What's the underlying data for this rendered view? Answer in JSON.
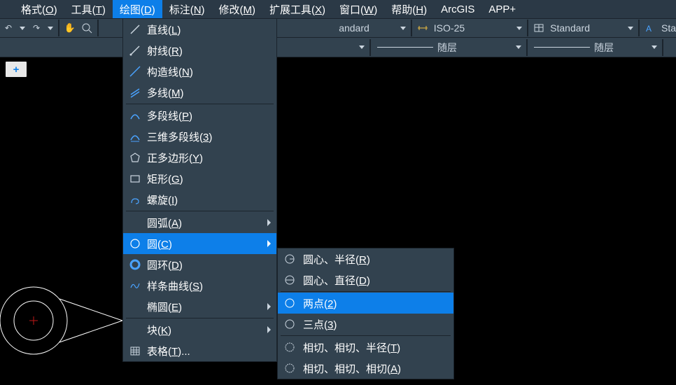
{
  "menubar": {
    "items": [
      {
        "label": "格式(O)"
      },
      {
        "label": "工具(T)"
      },
      {
        "label": "绘图(D)",
        "selected": true
      },
      {
        "label": "标注(N)"
      },
      {
        "label": "修改(M)"
      },
      {
        "label": "扩展工具(X)"
      },
      {
        "label": "窗口(W)"
      },
      {
        "label": "帮助(H)"
      },
      {
        "label": "ArcGIS"
      },
      {
        "label": "APP+"
      }
    ]
  },
  "toolbar": {
    "undo": "↶",
    "redo": "↷",
    "combos": [
      {
        "text": "andard"
      },
      {
        "text": "ISO-25"
      },
      {
        "text": "Standard"
      },
      {
        "text": "Sta"
      }
    ]
  },
  "toolbar2": {
    "bylayer1": "随层",
    "bylayer2": "随层"
  },
  "dropdown": {
    "items": [
      {
        "key": "line",
        "label_html": "直线(<u>L</u>)",
        "icon_svg": "<line x1='3' y1='15' x2='15' y2='3' stroke='#cbd5df' stroke-width='1.5'/>"
      },
      {
        "key": "ray",
        "label_html": "射线(<u>R</u>)",
        "icon_svg": "<line x1='3' y1='15' x2='15' y2='3' stroke='#cbd5df' stroke-width='1.5'/><circle cx='3' cy='15' r='1.5' fill='#cbd5df'/>"
      },
      {
        "key": "xline",
        "label_html": "构造线(<u>N</u>)",
        "icon_svg": "<line x1='2' y1='16' x2='16' y2='2' stroke='#4aa3ff' stroke-width='1.5'/>"
      },
      {
        "key": "mline",
        "label_html": "多线(<u>M</u>)",
        "icon_svg": "<line x1='3' y1='12' x2='15' y2='4' stroke='#4aa3ff' stroke-width='1.5'/><line x1='3' y1='16' x2='15' y2='8' stroke='#4aa3ff' stroke-width='1.5'/>"
      },
      {
        "sep": true
      },
      {
        "key": "pline",
        "label_html": "多段线(<u>P</u>)",
        "icon_svg": "<path d='M3 14 Q9 2 15 14' stroke='#4aa3ff' stroke-width='1.5' fill='none'/>"
      },
      {
        "key": "3dpoly",
        "label_html": "三维多段线(<u>3</u>)",
        "icon_svg": "<path d='M3 14 Q9 2 15 14' stroke='#4aa3ff' stroke-width='1.5' fill='none'/><line x1='3' y1='16' x2='15' y2='16' stroke='#4aa3ff'/>"
      },
      {
        "key": "polygon",
        "label_html": "正多边形(<u>Y</u>)",
        "icon_svg": "<polygon points='9,3 15,7 13,15 5,15 3,7' stroke='#cbd5df' fill='none' stroke-width='1.2'/>"
      },
      {
        "key": "rect",
        "label_html": "矩形(<u>G</u>)",
        "icon_svg": "<rect x='3' y='5' width='12' height='9' stroke='#cbd5df' fill='none' stroke-width='1.2'/>"
      },
      {
        "key": "helix",
        "label_html": "螺旋(<u>I</u>)",
        "icon_svg": "<path d='M4 14 Q4 8 9 8 Q14 8 14 12 Q14 15 10 15' stroke='#4aa3ff' fill='none' stroke-width='1.2'/>"
      },
      {
        "sep": true
      },
      {
        "key": "arc",
        "label_html": "圆弧(<u>A</u>)",
        "has_sub": true,
        "icon_svg": ""
      },
      {
        "key": "circle",
        "label_html": "圆(<u>C</u>)",
        "has_sub": true,
        "highlight": true,
        "icon_svg": "<circle cx='9' cy='9' r='6' stroke='#fff' fill='none' stroke-width='1.2'/>"
      },
      {
        "key": "donut",
        "label_html": "圆环(<u>D</u>)",
        "icon_svg": "<circle cx='9' cy='9' r='6' stroke='#4aa3ff' fill='none' stroke-width='3'/>"
      },
      {
        "key": "spline",
        "label_html": "样条曲线(<u>S</u>)",
        "icon_svg": "<path d='M3 12 Q6 4 9 10 Q12 16 15 6' stroke='#4aa3ff' fill='none' stroke-width='1.2'/>"
      },
      {
        "key": "ellipse",
        "label_html": "椭圆(<u>E</u>)",
        "has_sub": true,
        "icon_svg": ""
      },
      {
        "sep": true
      },
      {
        "key": "block",
        "label_html": "块(<u>K</u>)",
        "has_sub": true,
        "icon_svg": ""
      },
      {
        "key": "table",
        "label_html": "表格(<u>T</u>)...",
        "icon_svg": "<rect x='3' y='4' width='12' height='11' stroke='#cbd5df' fill='none'/><line x1='3' y1='8' x2='15' y2='8' stroke='#cbd5df'/><line x1='3' y1='11' x2='15' y2='11' stroke='#cbd5df'/><line x1='7' y1='4' x2='7' y2='15' stroke='#cbd5df'/><line x1='11' y1='4' x2='11' y2='15' stroke='#cbd5df'/>"
      }
    ]
  },
  "submenu": {
    "items": [
      {
        "key": "cenrad",
        "label_html": "圆心、半径(<u>R</u>)",
        "icon_svg": "<circle cx='9' cy='9' r='6' stroke='#cbd5df' fill='none'/><line x1='9' y1='9' x2='15' y2='9' stroke='#cbd5df'/>"
      },
      {
        "key": "cendia",
        "label_html": "圆心、直径(<u>D</u>)",
        "icon_svg": "<circle cx='9' cy='9' r='6' stroke='#cbd5df' fill='none'/><line x1='3' y1='9' x2='15' y2='9' stroke='#cbd5df'/>"
      },
      {
        "sep": true
      },
      {
        "key": "2p",
        "label_html": "两点(<u>2</u>)",
        "highlight": true,
        "icon_svg": "<circle cx='9' cy='9' r='6' stroke='#fff' fill='none'/>"
      },
      {
        "key": "3p",
        "label_html": "三点(<u>3</u>)",
        "icon_svg": "<circle cx='9' cy='9' r='6' stroke='#cbd5df' fill='none'/>"
      },
      {
        "sep": true
      },
      {
        "key": "ttr",
        "label_html": "相切、相切、半径(<u>T</u>)",
        "icon_svg": "<circle cx='9' cy='9' r='6' stroke='#cbd5df' fill='none' stroke-dasharray='2 1'/>"
      },
      {
        "key": "ttt",
        "label_html": "相切、相切、相切(<u>A</u>)",
        "icon_svg": "<circle cx='9' cy='9' r='6' stroke='#cbd5df' fill='none' stroke-dasharray='2 1'/>"
      }
    ]
  },
  "tab": {
    "plus": "+"
  }
}
